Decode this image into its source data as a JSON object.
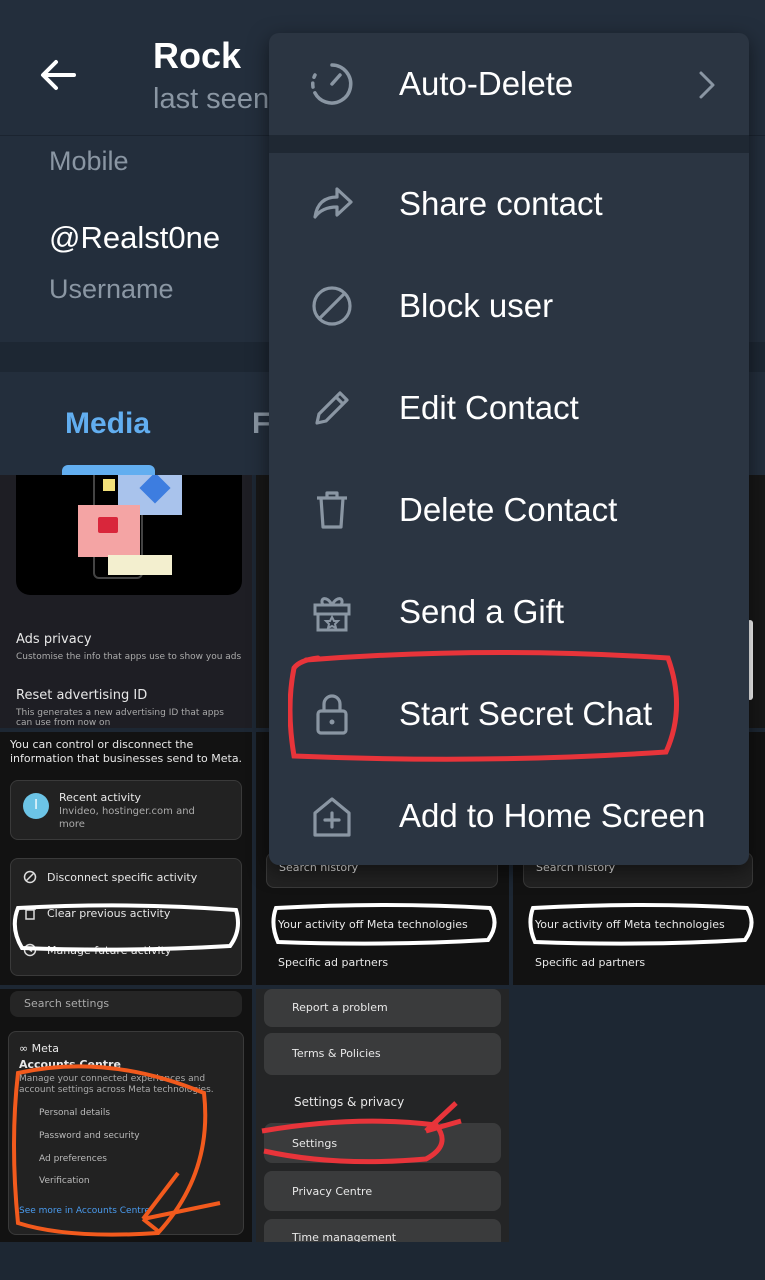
{
  "header": {
    "title": "Rock",
    "subtitle": "last seen"
  },
  "info": {
    "mobile_label": "Mobile",
    "username": "@Realst0ne",
    "username_label": "Username"
  },
  "tabs": {
    "media": "Media",
    "files_partial": "F"
  },
  "menu": {
    "items": [
      {
        "label": "Auto-Delete",
        "icon": "timer-icon"
      },
      {
        "label": "Share contact",
        "icon": "share-icon"
      },
      {
        "label": "Block user",
        "icon": "block-icon"
      },
      {
        "label": "Edit Contact",
        "icon": "pencil-icon"
      },
      {
        "label": "Delete Contact",
        "icon": "trash-icon"
      },
      {
        "label": "Send a Gift",
        "icon": "gift-icon"
      },
      {
        "label": "Start Secret Chat",
        "icon": "lock-icon"
      },
      {
        "label": "Add to Home Screen",
        "icon": "add-home-icon"
      }
    ]
  },
  "thumbs": {
    "ads": {
      "ads_privacy": "Ads privacy",
      "ads_privacy_desc": "Customise the info that apps use to show you ads",
      "reset_id": "Reset advertising ID",
      "reset_id_desc": "This generates a new advertising ID that apps can use from now on"
    },
    "activity": {
      "intro": "You can control or disconnect the information that businesses send to Meta.",
      "recent_title": "Recent activity",
      "recent_sub": "Invideo, hostinger.com and more",
      "recent_avatar": "I",
      "disconnect": "Disconnect specific activity",
      "clear": "Clear previous activity",
      "manage": "Manage future activity"
    },
    "offmeta": {
      "search_history": "Search history",
      "activity_off": "Your activity off Meta technologies",
      "partners": "Specific ad partners"
    },
    "accounts": {
      "search": "Search settings",
      "meta": "∞ Meta",
      "title": "Accounts Centre",
      "desc": "Manage your connected experiences and account settings across Meta technologies.",
      "personal": "Personal details",
      "password": "Password and security",
      "ad_prefs": "Ad preferences",
      "verification": "Verification",
      "see_more": "See more in Accounts Centre"
    },
    "fb": {
      "report": "Report a problem",
      "terms": "Terms & Policies",
      "section": "Settings & privacy",
      "settings": "Settings",
      "privacy": "Privacy Centre",
      "time": "Time management"
    }
  },
  "colors": {
    "accent": "#62aef0",
    "menu_bg": "#2b3542",
    "header_bg": "#232e3c",
    "annotation_red": "#e8343a",
    "annotation_orange": "#f25a1d"
  }
}
